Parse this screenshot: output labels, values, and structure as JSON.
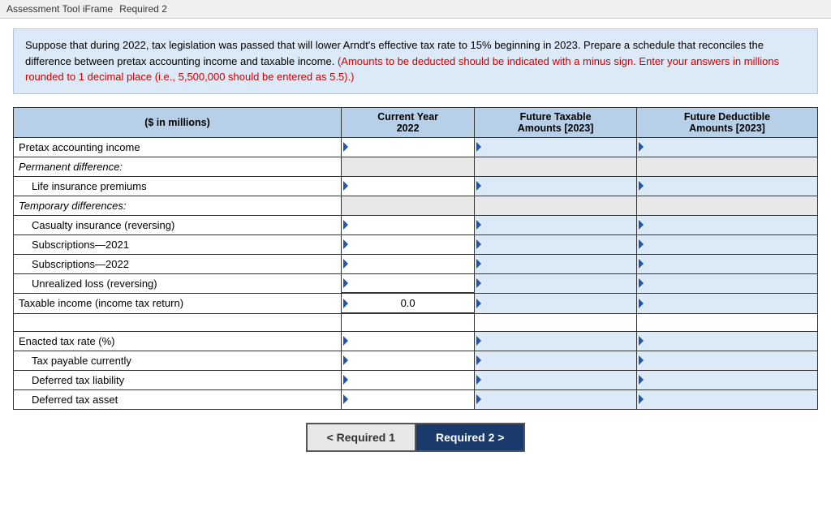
{
  "topBar": {
    "label": "Assessment Tool iFrame",
    "tab": "Required 2"
  },
  "instruction": {
    "main": "Suppose that during 2022, tax legislation was passed that will lower Arndt's effective tax rate to 15% beginning in 2023. Prepare a schedule that reconciles the difference between pretax accounting income and taxable income.",
    "red": "(Amounts to be deducted should be indicated with a minus sign. Enter your answers in millions rounded to 1 decimal place (i.e., 5,500,000 should be entered as 5.5).)"
  },
  "table": {
    "headers": {
      "rowLabel": "($ in millions)",
      "col1": "Current Year\n2022",
      "col2": "Future Taxable\nAmounts [2023]",
      "col3": "Future Deductible\nAmounts [2023]"
    },
    "rows": [
      {
        "label": "Pretax accounting income",
        "indent": false,
        "italic": false,
        "col1": "",
        "col2": "",
        "col3": "",
        "col1Blue": false,
        "col2Blue": true,
        "col3Blue": true
      },
      {
        "label": "Permanent difference:",
        "indent": false,
        "italic": true,
        "col1": "",
        "col2": "",
        "col3": "",
        "col1Blue": false,
        "col2Blue": false,
        "col3Blue": false,
        "noInput": true
      },
      {
        "label": "Life insurance premiums",
        "indent": true,
        "italic": false,
        "col1": "",
        "col2": "",
        "col3": "",
        "col1Blue": false,
        "col2Blue": true,
        "col3Blue": true
      },
      {
        "label": "Temporary differences:",
        "indent": false,
        "italic": true,
        "col1": "",
        "col2": "",
        "col3": "",
        "col1Blue": false,
        "col2Blue": false,
        "col3Blue": false,
        "noInput": true
      },
      {
        "label": "Casualty insurance (reversing)",
        "indent": true,
        "italic": false,
        "col1": "",
        "col2": "",
        "col3": "",
        "col1Blue": false,
        "col2Blue": true,
        "col3Blue": true
      },
      {
        "label": "Subscriptions—2021",
        "indent": true,
        "italic": false,
        "col1": "",
        "col2": "",
        "col3": "",
        "col1Blue": false,
        "col2Blue": true,
        "col3Blue": true
      },
      {
        "label": "Subscriptions—2022",
        "indent": true,
        "italic": false,
        "col1": "",
        "col2": "",
        "col3": "",
        "col1Blue": false,
        "col2Blue": true,
        "col3Blue": true
      },
      {
        "label": "Unrealized loss (reversing)",
        "indent": true,
        "italic": false,
        "col1": "",
        "col2": "",
        "col3": "",
        "col1Blue": false,
        "col2Blue": true,
        "col3Blue": true
      },
      {
        "label": "Taxable income (income tax return)",
        "indent": false,
        "italic": false,
        "col1": "0.0",
        "col2": "",
        "col3": "",
        "col1Blue": false,
        "col2Blue": true,
        "col3Blue": true,
        "isTotal": true
      },
      {
        "label": "",
        "indent": false,
        "italic": false,
        "col1": "",
        "col2": "",
        "col3": "",
        "isEmpty": true
      },
      {
        "label": "Enacted tax rate (%)",
        "indent": false,
        "italic": false,
        "col1": "",
        "col2": "",
        "col3": "",
        "col1Blue": false,
        "col2Blue": true,
        "col3Blue": true
      },
      {
        "label": "Tax payable currently",
        "indent": true,
        "italic": false,
        "col1": "",
        "col2": "",
        "col3": "",
        "col1Blue": false,
        "col2Blue": true,
        "col3Blue": true
      },
      {
        "label": "Deferred tax liability",
        "indent": true,
        "italic": false,
        "col1": "",
        "col2": "",
        "col3": "",
        "col1Blue": false,
        "col2Blue": true,
        "col3Blue": true
      },
      {
        "label": "Deferred tax asset",
        "indent": true,
        "italic": false,
        "col1": "",
        "col2": "",
        "col3": "",
        "col1Blue": false,
        "col2Blue": true,
        "col3Blue": true
      }
    ]
  },
  "nav": {
    "prev": "< Required 1",
    "next": "Required 2  >"
  }
}
